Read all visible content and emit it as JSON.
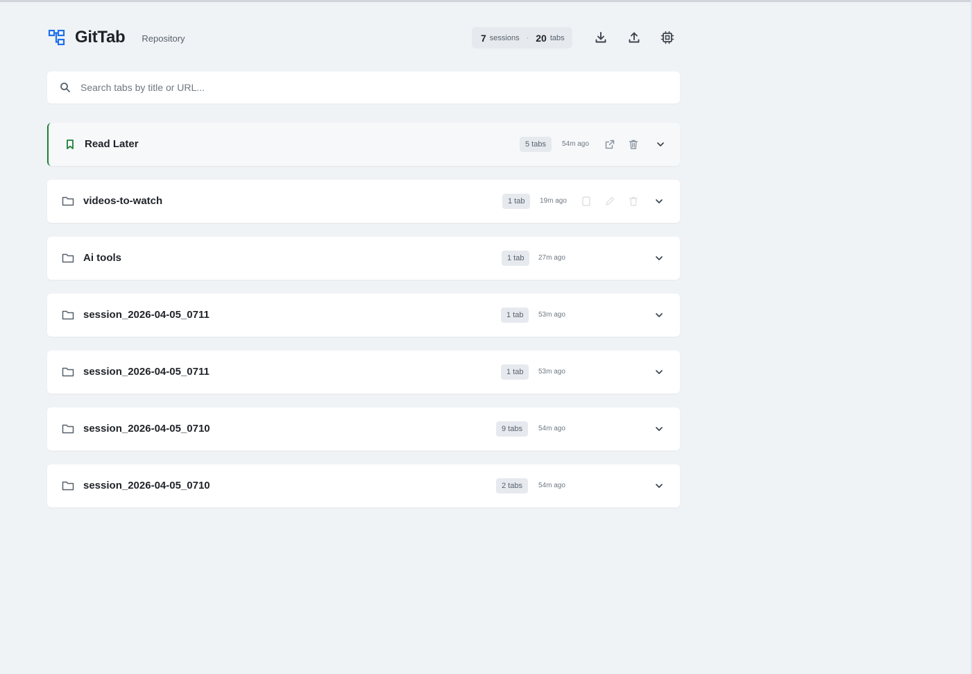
{
  "header": {
    "title": "GitTab",
    "subtitle": "Repository",
    "sessions_count": "7",
    "sessions_label": "sessions",
    "separator": "·",
    "tabs_count": "20",
    "tabs_label": "tabs",
    "accent_color": "#1f6feb",
    "icons": [
      "gittab-logo-icon",
      "download-icon",
      "upload-icon",
      "settings-chip-icon"
    ]
  },
  "search": {
    "placeholder": "Search tabs by title or URL..."
  },
  "pinned_color": "#1a7f37",
  "sessions": [
    {
      "name": "Read Later",
      "count": "5 tabs",
      "time": "54m ago",
      "icon": "bookmark-icon",
      "pinned": true
    },
    {
      "name": "videos-to-watch",
      "count": "1 tab",
      "time": "19m ago",
      "icon": "folder-icon"
    },
    {
      "name": "Ai tools",
      "count": "1 tab",
      "time": "27m ago",
      "icon": "folder-icon"
    },
    {
      "name": "session_2026-04-05_0711",
      "count": "1 tab",
      "time": "53m ago",
      "icon": "folder-icon"
    },
    {
      "name": "session_2026-04-05_0711",
      "count": "1 tab",
      "time": "53m ago",
      "icon": "folder-icon"
    },
    {
      "name": "session_2026-04-05_0710",
      "count": "9 tabs",
      "time": "54m ago",
      "icon": "folder-icon"
    },
    {
      "name": "session_2026-04-05_0710",
      "count": "2 tabs",
      "time": "54m ago",
      "icon": "folder-icon"
    }
  ]
}
